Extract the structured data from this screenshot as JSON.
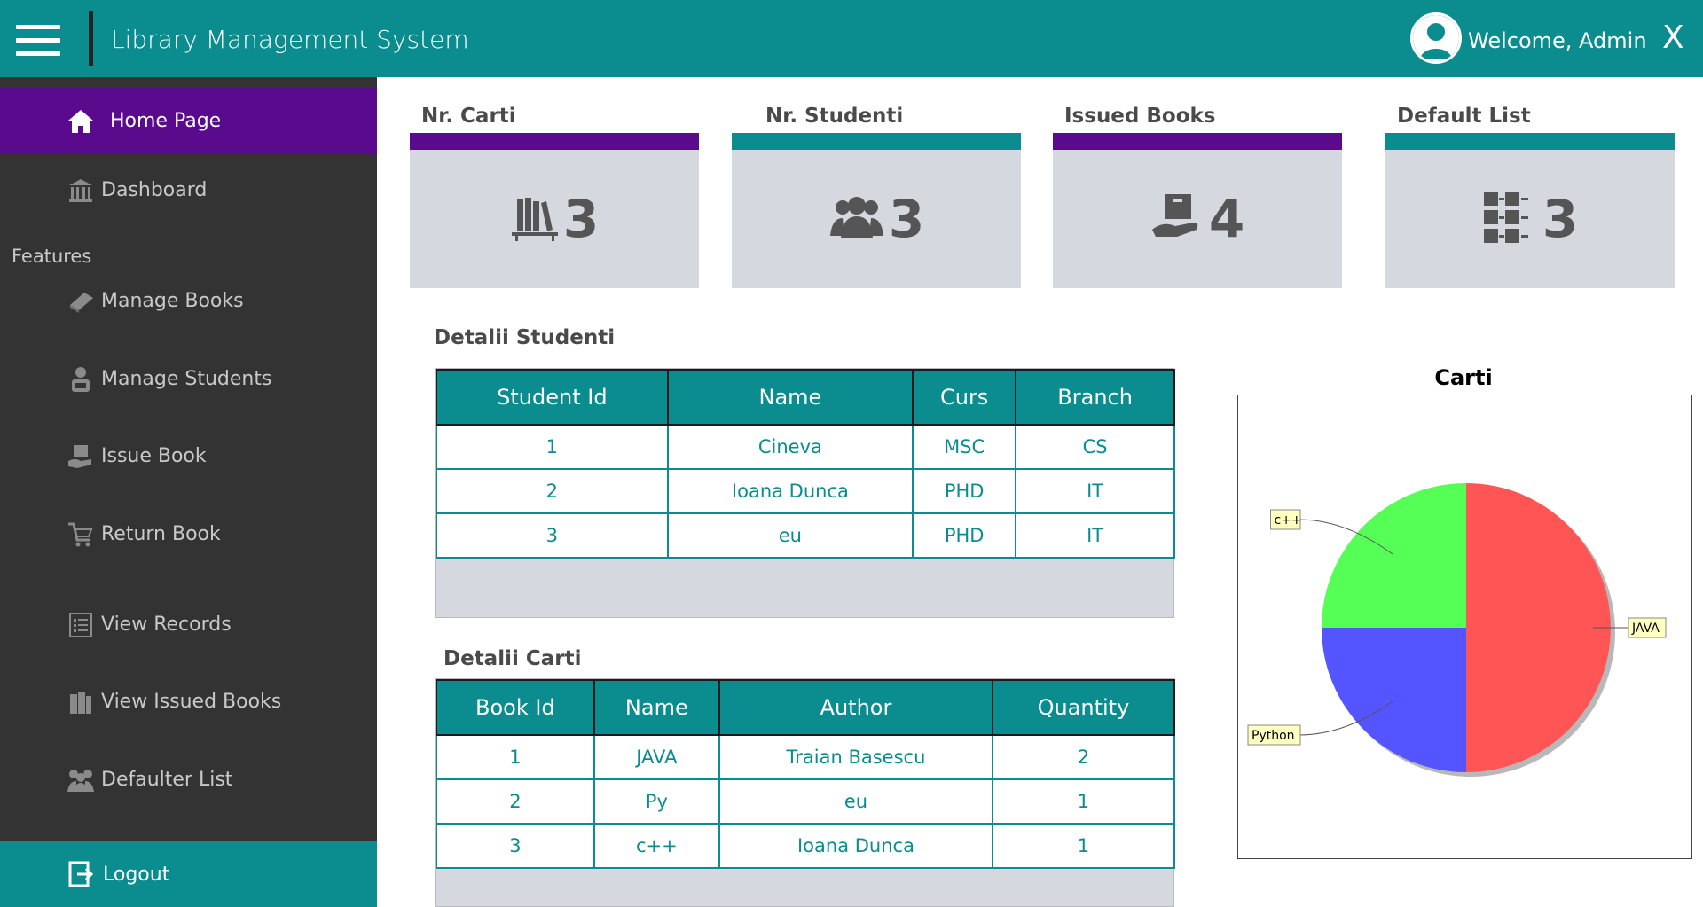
{
  "header": {
    "title": "Library Management System",
    "welcome": "Welcome, Admin",
    "close": "X"
  },
  "sidebar": {
    "home": "Home Page",
    "dashboard": "Dashboard",
    "features": "Features",
    "items": [
      {
        "label": "Manage Books",
        "icon": "book-icon"
      },
      {
        "label": "Manage Students",
        "icon": "student-icon"
      },
      {
        "label": "Issue Book",
        "icon": "issue-book-icon"
      },
      {
        "label": "Return Book",
        "icon": "return-cart-icon"
      },
      {
        "label": "View Records",
        "icon": "list-icon"
      },
      {
        "label": "View Issued Books",
        "icon": "books-icon"
      },
      {
        "label": "Defaulter List",
        "icon": "people-icon"
      }
    ],
    "logout": "Logout"
  },
  "cards": [
    {
      "title": "Nr. Carti",
      "value": "3",
      "color": "#5a0a8c",
      "icon": "bookshelf-icon"
    },
    {
      "title": "Nr. Studenti",
      "value": "3",
      "color": "#0b8c8f",
      "icon": "users-icon"
    },
    {
      "title": "Issued Books",
      "value": "4",
      "color": "#5a0a8c",
      "icon": "hand-book-icon"
    },
    {
      "title": "Default List",
      "value": "3",
      "color": "#0b8c8f",
      "icon": "grid-list-icon"
    }
  ],
  "students": {
    "title": "Detalii Studenti",
    "columns": [
      "Student Id",
      "Name",
      "Curs",
      "Branch"
    ],
    "rows": [
      [
        "1",
        "Cineva",
        "MSC",
        "CS"
      ],
      [
        "2",
        "Ioana Dunca",
        "PHD",
        "IT"
      ],
      [
        "3",
        "eu",
        "PHD",
        "IT"
      ]
    ]
  },
  "books": {
    "title": "Detalii Carti",
    "columns": [
      "Book Id",
      "Name",
      "Author",
      "Quantity"
    ],
    "rows": [
      [
        "1",
        "JAVA",
        "Traian Basescu",
        "2"
      ],
      [
        "2",
        "Py",
        "eu",
        "1"
      ],
      [
        "3",
        "c++",
        "Ioana Dunca",
        "1"
      ]
    ]
  },
  "chart_data": {
    "type": "pie",
    "title": "Carti",
    "categories": [
      "JAVA",
      "Python",
      "c++"
    ],
    "values": [
      2,
      1,
      1
    ],
    "colors": [
      "#ff5555",
      "#5555ff",
      "#55ff55"
    ]
  }
}
